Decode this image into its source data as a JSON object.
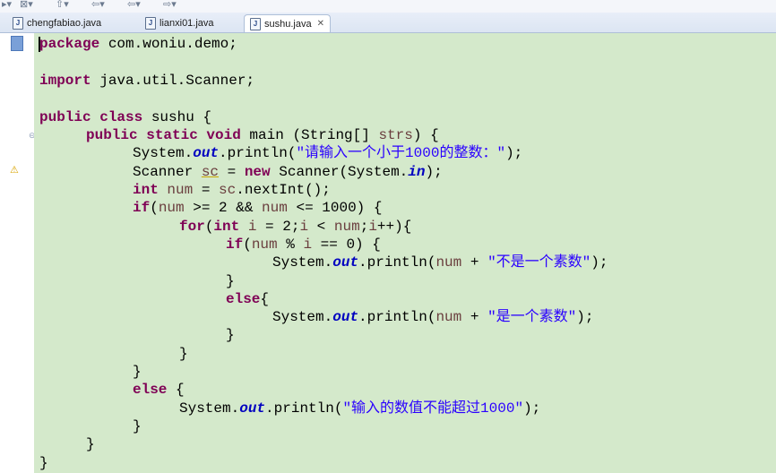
{
  "tabs": [
    {
      "label": "chengfabiao.java",
      "active": false
    },
    {
      "label": "lianxi01.java",
      "active": false
    },
    {
      "label": "sushu.java",
      "active": true
    }
  ],
  "code": {
    "l1_kw": "package",
    "l1_rest": " com.woniu.demo;",
    "l2_kw": "import",
    "l2_rest": " java.util.Scanner;",
    "l3_kw": "public class",
    "l3_rest": " sushu {",
    "l4_kw": "public static void",
    "l4_rest": " main (String[] ",
    "l4_var": "strs",
    "l4_end": ") {",
    "l5_a": "System.",
    "l5_fld": "out",
    "l5_b": ".println(",
    "l5_str": "\"请输入一个小于1000的整数：\"",
    "l5_c": ");",
    "l6_a": "Scanner ",
    "l6_var": "sc",
    "l6_b": " = ",
    "l6_kw": "new",
    "l6_c": " Scanner(System.",
    "l6_fld": "in",
    "l6_d": ");",
    "l7_kw": "int",
    "l7_a": " ",
    "l7_var": "num",
    "l7_b": " = ",
    "l7_var2": "sc",
    "l7_c": ".nextInt();",
    "l8_kw": "if",
    "l8_a": "(",
    "l8_var": "num",
    "l8_b": " >= 2 && ",
    "l8_var2": "num",
    "l8_c": " <= 1000) {",
    "l9_kw": "for",
    "l9_a": "(",
    "l9_kw2": "int",
    "l9_b": " ",
    "l9_var": "i",
    "l9_c": " = 2;",
    "l9_var2": "i",
    "l9_d": " < ",
    "l9_var3": "num",
    "l9_e": ";",
    "l9_var4": "i",
    "l9_f": "++){",
    "l10_kw": "if",
    "l10_a": "(",
    "l10_var": "num",
    "l10_b": " % ",
    "l10_var2": "i",
    "l10_c": " == 0) {",
    "l11_a": "System.",
    "l11_fld": "out",
    "l11_b": ".println(",
    "l11_var": "num",
    "l11_c": " + ",
    "l11_str": "\"不是一个素数\"",
    "l11_d": ");",
    "l12": "}",
    "l13_kw": "else",
    "l13_a": "{",
    "l14_a": "System.",
    "l14_fld": "out",
    "l14_b": ".println(",
    "l14_var": "num",
    "l14_c": " + ",
    "l14_str": "\"是一个素数\"",
    "l14_d": ");",
    "l15": "}",
    "l16": "}",
    "l17": "}",
    "l18_kw": "else",
    "l18_a": " {",
    "l19_a": "System.",
    "l19_fld": "out",
    "l19_b": ".println(",
    "l19_str": "\"输入的数值不能超过1000\"",
    "l19_c": ");",
    "l20": "}",
    "l21": "}",
    "l22": "}"
  },
  "icons": {
    "java_file": "J",
    "close": "✕",
    "fold": "⊖",
    "warning": "⚠"
  },
  "colors": {
    "editor_bg": "#d4e9cb",
    "keyword": "#7f0055",
    "string": "#2a00ff",
    "field": "#0000c0",
    "variable": "#6a3e3e"
  }
}
